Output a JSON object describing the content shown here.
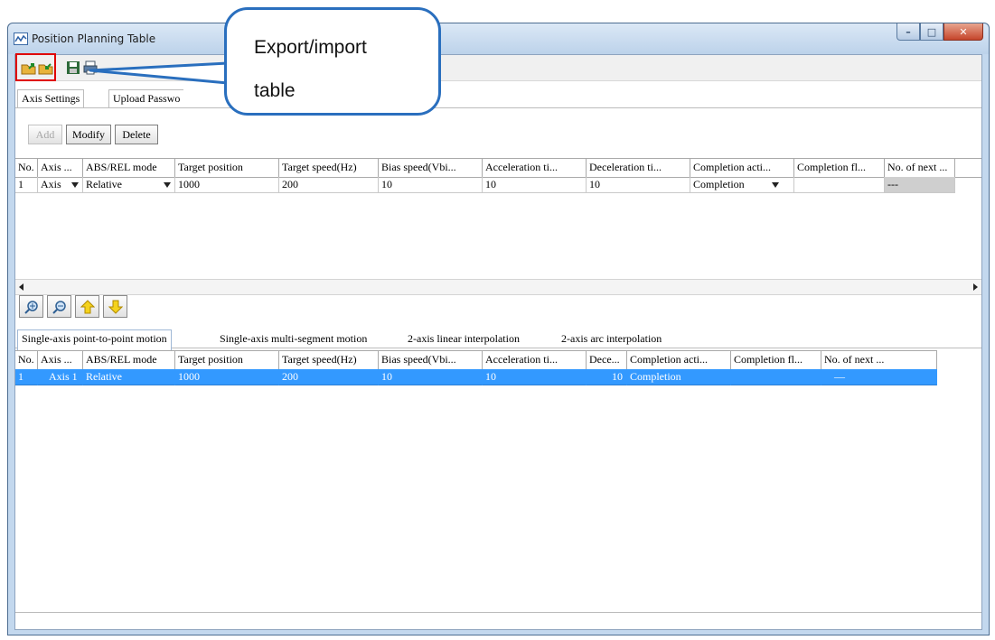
{
  "window": {
    "title": "Position Planning Table"
  },
  "callout": {
    "line1": "Export/import",
    "line2": "table"
  },
  "axis_tabs": [
    "Axis Settings",
    "Upload Passwo"
  ],
  "buttons": {
    "add": "Add",
    "modify": "Modify",
    "delete": "Delete"
  },
  "top_grid": {
    "headers": [
      "No.",
      "Axis ...",
      "ABS/REL mode",
      "Target position",
      "Target speed(Hz)",
      "Bias speed(Vbi...",
      "Acceleration ti...",
      "Deceleration ti...",
      "Completion acti...",
      "Completion fl...",
      "No. of next ..."
    ],
    "row": {
      "no": "1",
      "axis": "Axis",
      "mode": "Relative",
      "target_position": "1000",
      "target_speed": "200",
      "bias_speed": "10",
      "acceleration": "10",
      "deceleration": "10",
      "completion_action": "Completion",
      "completion_flag": "",
      "next": "---"
    }
  },
  "motion_tabs": [
    "Single-axis point-to-point motion",
    "Single-axis multi-segment motion",
    "2-axis linear interpolation",
    "2-axis arc interpolation"
  ],
  "bottom_grid": {
    "headers": [
      "No.",
      "Axis ...",
      "ABS/REL mode",
      "Target position",
      "Target speed(Hz)",
      "Bias speed(Vbi...",
      "Acceleration ti...",
      "Dece...",
      "Completion acti...",
      "Completion fl...",
      "No. of next ..."
    ],
    "row": {
      "no": "1",
      "axis": "Axis 1",
      "mode": "Relative",
      "target_position": "1000",
      "target_speed": "200",
      "bias_speed": "10",
      "acceleration": "10",
      "deceleration": "10",
      "completion_action": "Completion",
      "completion_flag": "",
      "next": "—"
    }
  },
  "icons": [
    "export-icon",
    "import-icon",
    "save-icon",
    "print-icon",
    "zoom-in-icon",
    "zoom-out-icon",
    "move-up-icon",
    "move-down-icon"
  ],
  "colors": {
    "selection": "#3399ff",
    "highlight_box": "#e00000",
    "callout_border": "#2a6fbe"
  }
}
